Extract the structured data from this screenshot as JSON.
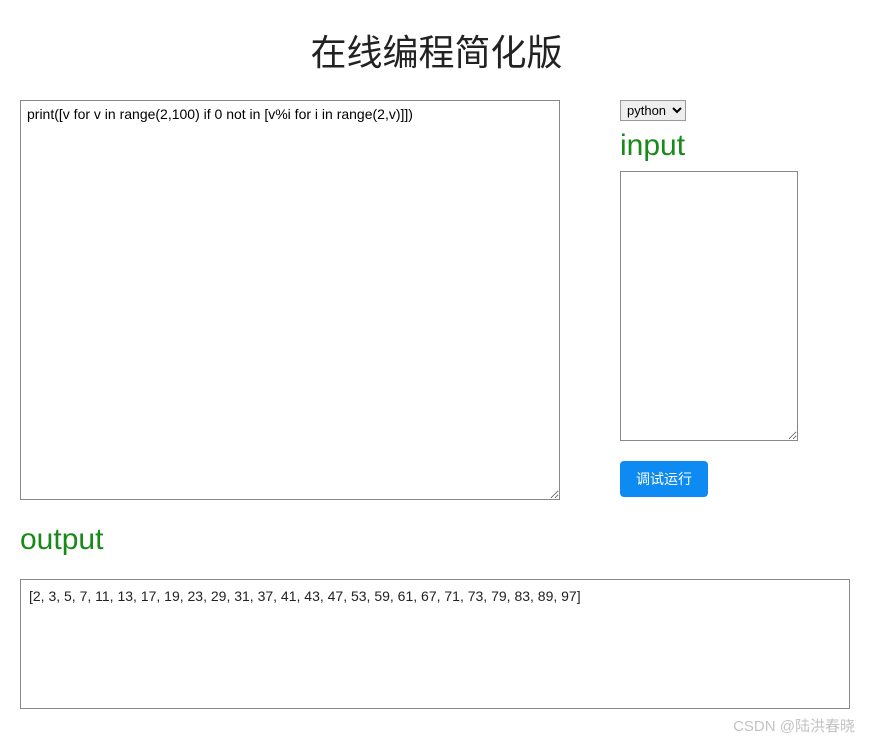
{
  "title": "在线编程简化版",
  "code": {
    "value": "print([v for v in range(2,100) if 0 not in [v%i for i in range(2,v)]])"
  },
  "language": {
    "selected": "python",
    "options": [
      "python"
    ]
  },
  "input": {
    "heading": "input",
    "value": ""
  },
  "run": {
    "label": "调试运行"
  },
  "output": {
    "heading": "output",
    "value": "[2, 3, 5, 7, 11, 13, 17, 19, 23, 29, 31, 37, 41, 43, 47, 53, 59, 61, 67, 71, 73, 79, 83, 89, 97]"
  },
  "watermark": "CSDN @陆洪春晓"
}
